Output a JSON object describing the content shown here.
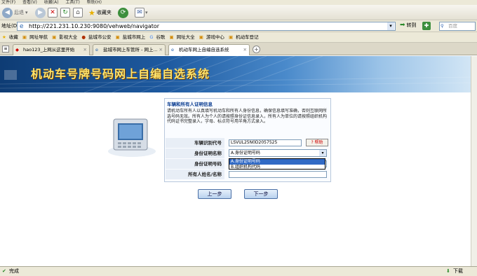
{
  "menubar": {
    "items": [
      "文件(F)",
      "查看(V)",
      "收藏(A)",
      "工具(T)",
      "帮助(H)"
    ]
  },
  "nav": {
    "back": "后退",
    "favorites": "收藏夹"
  },
  "address": {
    "label": "地址(D)",
    "url": "http://221.231.10.230:9080/vehweb/navigator",
    "go": "转到",
    "search_placeholder": "百度"
  },
  "favbar": {
    "items": [
      "收藏",
      "网址导航",
      "影视大全",
      "盐城市公安",
      "盐城市网上",
      "谷歌",
      "网址大全",
      "游戏中心",
      "机动车登记"
    ]
  },
  "tabs": [
    {
      "label": "hao123_上网从这里开始"
    },
    {
      "label": "盐城市网上车管所 - 网上..."
    },
    {
      "label": "机动车网上自编自选系统"
    }
  ],
  "banner": {
    "title": "机动车号牌号码网上自编自选系统"
  },
  "panel": {
    "heading": "车辆和所有人证明信息",
    "notice": "请机动车所有人以真填写机动车和所有人身份信息，确保信息填写准确，否则互联网所选号码无效。所有人为个人的请按照身份证信息录入，所有人为单位的请按照组织机构代码证书完整录入，字母、标点符号用半角方式录入。",
    "rows": [
      {
        "label": "车辆识别代号",
        "value": "LSVUL25N0D2057525"
      },
      {
        "label": "身份证明名称",
        "value": "A.身份证明号码"
      },
      {
        "label": "身份证明号码",
        "value": ""
      },
      {
        "label": "所有人姓名/名称",
        "value": ""
      }
    ],
    "help": "帮助",
    "dropdown_options": [
      "A.身份证明号码",
      "B.组织机构代码"
    ]
  },
  "buttons": {
    "prev": "上一步",
    "next": "下一步"
  },
  "status": {
    "left": "完成",
    "right": "下载"
  },
  "colors": {
    "banner_dark": "#0e3c74",
    "banner_title": "#ffe36a",
    "selection": "#316ac5"
  }
}
